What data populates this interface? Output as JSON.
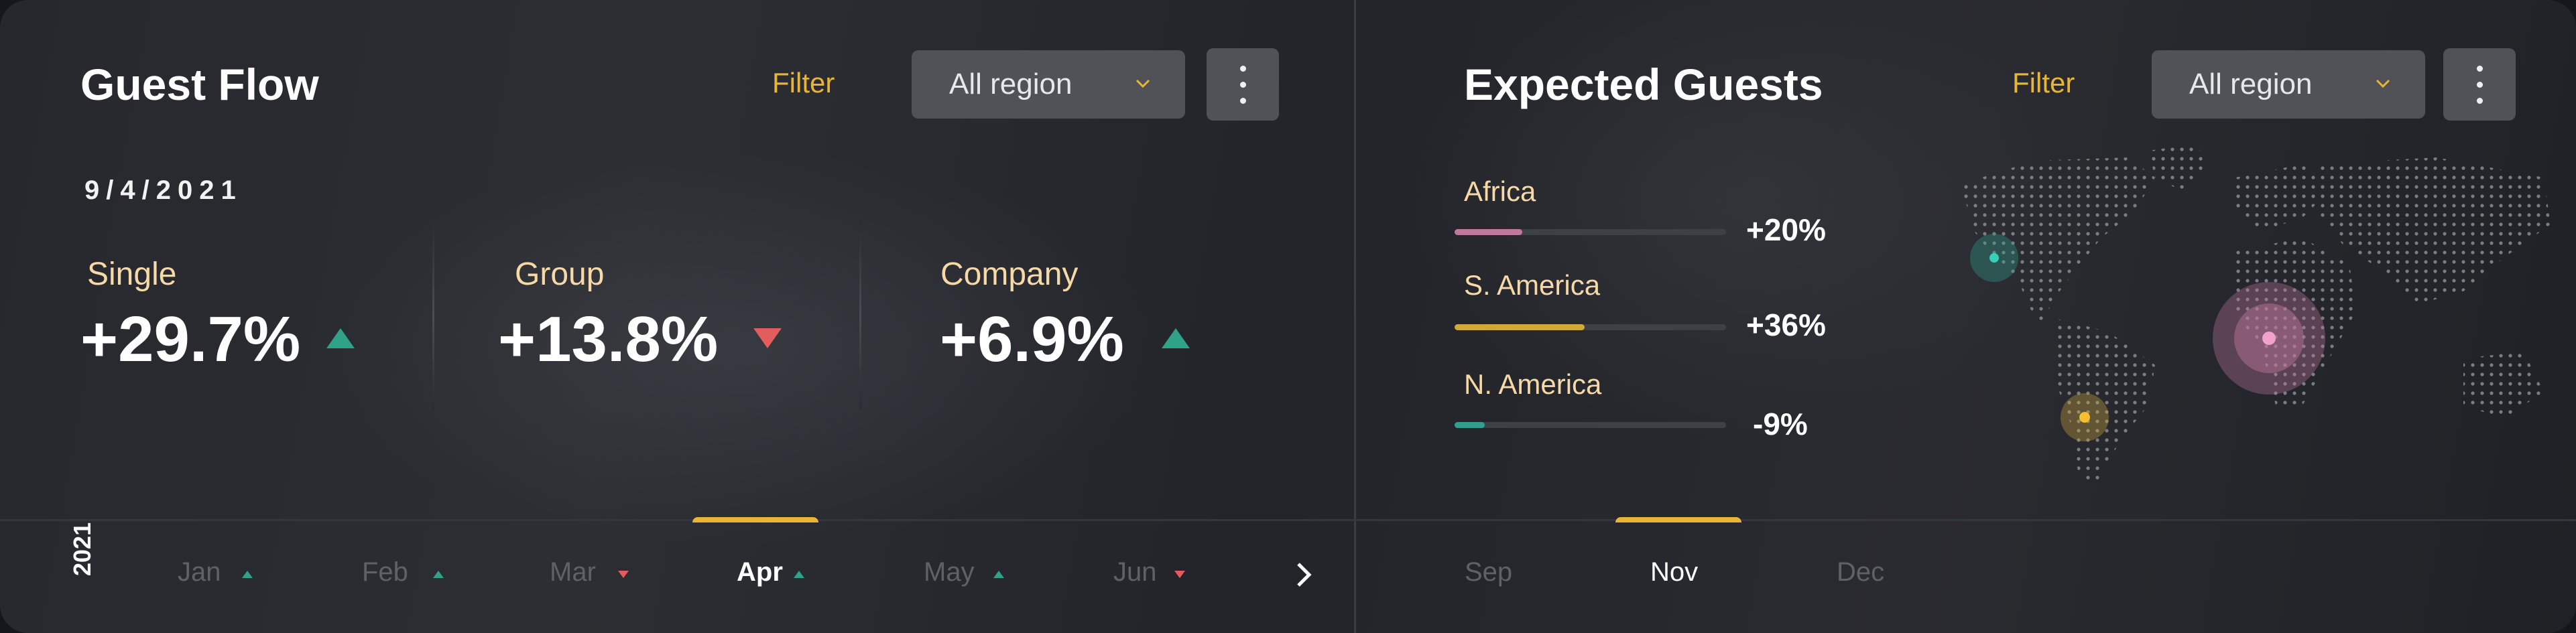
{
  "guest_flow": {
    "title": "Guest Flow",
    "filter_label": "Filter",
    "region_select": {
      "value": "All region"
    },
    "date": "9/4/2021",
    "stats": [
      {
        "label": "Single",
        "value": "+29.7%",
        "trend": "up"
      },
      {
        "label": "Group",
        "value": "+13.8%",
        "trend": "down"
      },
      {
        "label": "Company",
        "value": "+6.9%",
        "trend": "up"
      }
    ],
    "timeline": {
      "year": "2021",
      "months": [
        {
          "label": "Jan",
          "trend": "up"
        },
        {
          "label": "Feb",
          "trend": "up"
        },
        {
          "label": "Mar",
          "trend": "down"
        },
        {
          "label": "Apr",
          "trend": "up",
          "active": true
        },
        {
          "label": "May",
          "trend": "up"
        },
        {
          "label": "Jun",
          "trend": "down"
        }
      ]
    }
  },
  "expected_guests": {
    "title": "Expected Guests",
    "filter_label": "Filter",
    "region_select": {
      "value": "All region"
    },
    "regions": [
      {
        "label": "Africa",
        "value": "+20%",
        "progress": 0.25,
        "color": "#c0789f"
      },
      {
        "label": "S. America",
        "value": "+36%",
        "progress": 0.48,
        "color": "#d1a93b"
      },
      {
        "label": "N. America",
        "value": "-9%",
        "progress": 0.11,
        "color": "#2fa090"
      }
    ],
    "timeline": {
      "months": [
        {
          "label": "Sep"
        },
        {
          "label": "Nov",
          "active": true
        },
        {
          "label": "Dec"
        }
      ]
    }
  },
  "colors": {
    "accent": "#e9b537",
    "up": "#2fa287",
    "down": "#e35d5d",
    "card_bg": "#505257"
  }
}
